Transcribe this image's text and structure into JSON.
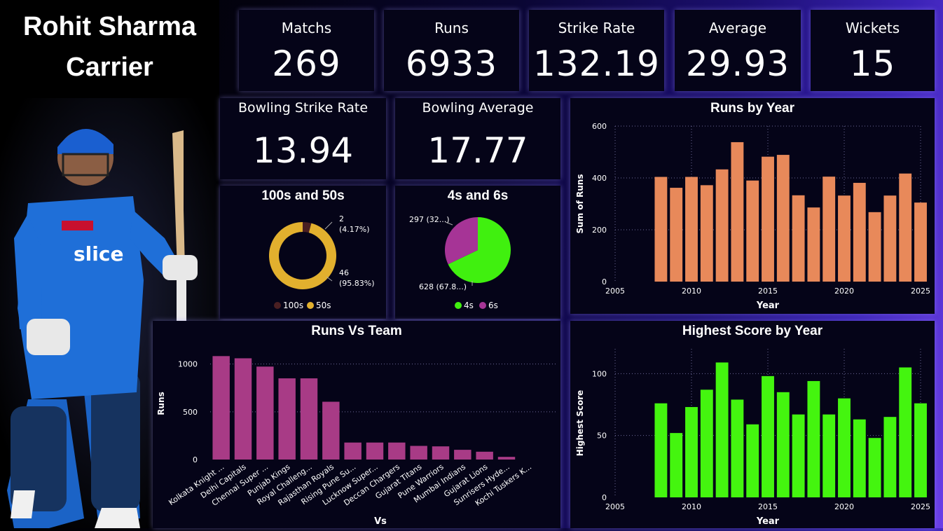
{
  "header": {
    "title_line1": "Rohit Sharma",
    "title_line2": "Carrier"
  },
  "kpis": [
    {
      "label": "Matchs",
      "value": "269"
    },
    {
      "label": "Runs",
      "value": "6933"
    },
    {
      "label": "Strike Rate",
      "value": "132.19"
    },
    {
      "label": "Average",
      "value": "29.93"
    },
    {
      "label": "Wickets",
      "value": "15"
    }
  ],
  "bowling": {
    "strike_rate_label": "Bowling Strike Rate",
    "strike_rate_value": "13.94",
    "average_label": "Bowling Average",
    "average_value": "17.77"
  },
  "colors": {
    "runs_bar": "#e8895a",
    "high_bar": "#44f50f",
    "team_bar": "#a83b86",
    "donut_50s": "#e2b02e",
    "donut_100s": "#4a1f22",
    "pie_4s": "#40f00f",
    "pie_6s": "#a63496"
  },
  "chart_data": [
    {
      "type": "pie",
      "title": "100s and 50s",
      "variant": "donut",
      "slices": [
        {
          "name": "100s",
          "value": 2,
          "label": "2",
          "pct": "(4.17%)"
        },
        {
          "name": "50s",
          "value": 46,
          "label": "46",
          "pct": "(95.83%)"
        }
      ],
      "legend": [
        "100s",
        "50s"
      ],
      "legend_position": "bottom"
    },
    {
      "type": "pie",
      "title": "4s and 6s",
      "slices": [
        {
          "name": "4s",
          "value": 628,
          "label": "628 (67.8...)"
        },
        {
          "name": "6s",
          "value": 297,
          "label": "297 (32...)"
        }
      ],
      "legend": [
        "4s",
        "6s"
      ],
      "legend_position": "bottom"
    },
    {
      "type": "bar",
      "title": "Runs by Year",
      "xlabel": "Year",
      "ylabel": "Sum of Runs",
      "x": [
        2008,
        2009,
        2010,
        2011,
        2012,
        2013,
        2014,
        2015,
        2016,
        2017,
        2018,
        2019,
        2020,
        2021,
        2022,
        2023,
        2024,
        2025
      ],
      "values": [
        404,
        362,
        404,
        372,
        433,
        538,
        390,
        482,
        489,
        333,
        286,
        405,
        332,
        381,
        268,
        332,
        417,
        305
      ],
      "ylim": [
        0,
        600
      ],
      "yticks": [
        0,
        200,
        400,
        600
      ],
      "xticks": [
        2005,
        2010,
        2015,
        2020,
        2025
      ],
      "grid": true
    },
    {
      "type": "bar",
      "title": "Highest Score by Year",
      "xlabel": "Year",
      "ylabel": "Highest Score",
      "x": [
        2008,
        2009,
        2010,
        2011,
        2012,
        2013,
        2014,
        2015,
        2016,
        2017,
        2018,
        2019,
        2020,
        2021,
        2022,
        2023,
        2024,
        2025
      ],
      "values": [
        76,
        52,
        73,
        87,
        109,
        79,
        59,
        98,
        85,
        67,
        94,
        67,
        80,
        63,
        48,
        65,
        105,
        76
      ],
      "ylim": [
        0,
        120
      ],
      "yticks": [
        0,
        50,
        100
      ],
      "xticks": [
        2005,
        2010,
        2015,
        2020,
        2025
      ],
      "grid": true
    },
    {
      "type": "bar",
      "title": "Runs Vs Team",
      "xlabel": "Vs",
      "ylabel": "Runs",
      "categories": [
        "Kolkata Knight ...",
        "Delhi Capitals",
        "Chennai Super ...",
        "Punjab Kings",
        "Royal Challeng...",
        "Rajasthan Royals",
        "Rising Pune Su...",
        "Lucknow Super...",
        "Deccan Chargers",
        "Gujarat Titans",
        "Pune Warriors",
        "Mumbai Indians",
        "Gujarat Lions",
        "Sunrisers Hyde...",
        "Kochi Tuskers K..."
      ],
      "values": [
        1083,
        1060,
        973,
        850,
        850,
        605,
        178,
        178,
        178,
        143,
        138,
        102,
        82,
        28,
        0
      ],
      "ylim": [
        0,
        1100
      ],
      "yticks": [
        0,
        500,
        1000
      ],
      "grid": true
    }
  ]
}
